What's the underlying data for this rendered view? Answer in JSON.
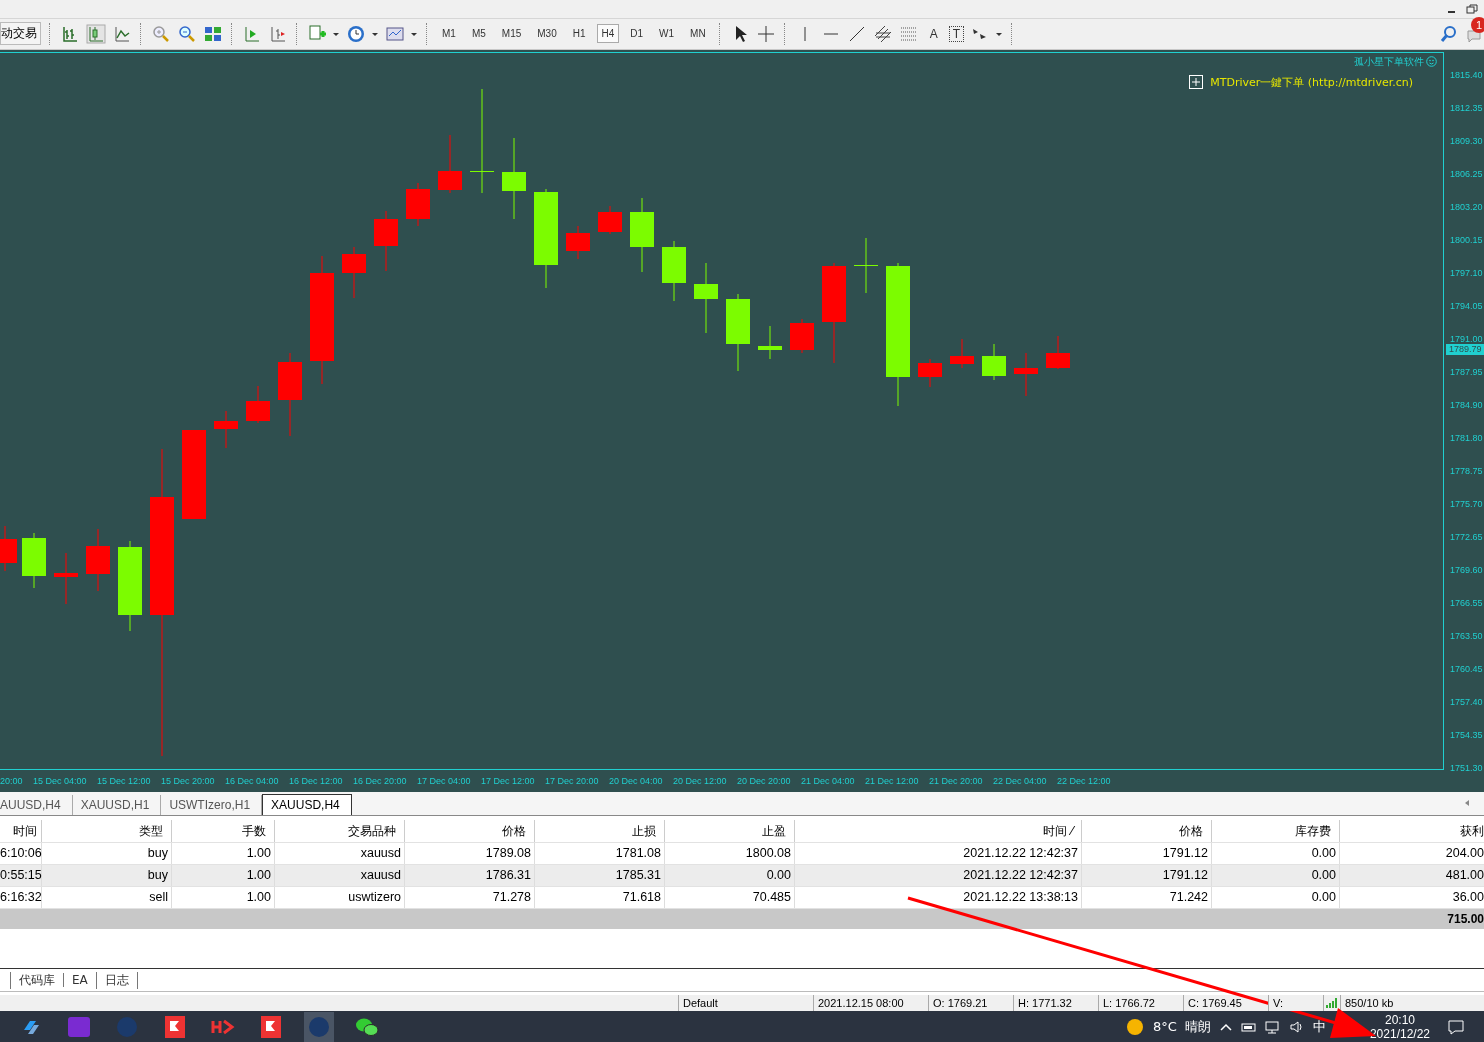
{
  "toolbar": {
    "autotrade_label": "动交易",
    "timeframes": [
      {
        "label": "M1",
        "selected": false
      },
      {
        "label": "M5",
        "selected": false
      },
      {
        "label": "M15",
        "selected": false
      },
      {
        "label": "M30",
        "selected": false
      },
      {
        "label": "H1",
        "selected": false
      },
      {
        "label": "H4",
        "selected": true
      },
      {
        "label": "D1",
        "selected": false
      },
      {
        "label": "W1",
        "selected": false
      },
      {
        "label": "MN",
        "selected": false
      }
    ],
    "text_tools": [
      "A",
      "T"
    ],
    "notification_count": "1"
  },
  "chart": {
    "branding": "孤小星下单软件",
    "plugin_label": "MTDriver一鍵下单 (http://mtdriver.cn)",
    "price_ticks": [
      "1815.40",
      "1812.35",
      "1809.30",
      "1806.25",
      "1803.20",
      "1800.15",
      "1797.10",
      "1794.05",
      "1791.00",
      "1787.95",
      "1784.90",
      "1781.80",
      "1778.75",
      "1775.70",
      "1772.65",
      "1769.60",
      "1766.55",
      "1763.50",
      "1760.45",
      "1757.40",
      "1754.35",
      "1751.30"
    ],
    "current_price": "1789.79",
    "time_labels": [
      "20:00",
      "15 Dec 04:00",
      "15 Dec 12:00",
      "15 Dec 20:00",
      "16 Dec 04:00",
      "16 Dec 12:00",
      "16 Dec 20:00",
      "17 Dec 04:00",
      "17 Dec 12:00",
      "17 Dec 20:00",
      "20 Dec 04:00",
      "20 Dec 12:00",
      "20 Dec 20:00",
      "21 Dec 04:00",
      "21 Dec 12:00",
      "21 Dec 20:00",
      "22 Dec 04:00",
      "22 Dec 12:00"
    ]
  },
  "chart_tabs": [
    {
      "label": "AUUSD,H4",
      "selected": false
    },
    {
      "label": "XAUUSD,H1",
      "selected": false
    },
    {
      "label": "USWTIzero,H1",
      "selected": false
    },
    {
      "label": "XAUUSD,H4",
      "selected": true
    }
  ],
  "trades": {
    "columns": [
      "时间",
      "类型",
      "手数",
      "交易品种",
      "价格",
      "止损",
      "止盈",
      "时间 ⁄",
      "价格",
      "库存费",
      "获利"
    ],
    "rows": [
      [
        "6:10:06",
        "buy",
        "1.00",
        "xauusd",
        "1789.08",
        "1781.08",
        "1800.08",
        "2021.12.22 12:42:37",
        "1791.12",
        "0.00",
        "204.00"
      ],
      [
        "0:55:15",
        "buy",
        "1.00",
        "xauusd",
        "1786.31",
        "1785.31",
        "0.00",
        "2021.12.22 12:42:37",
        "1791.12",
        "0.00",
        "481.00"
      ],
      [
        "6:16:32",
        "sell",
        "1.00",
        "uswtizero",
        "71.278",
        "71.618",
        "70.485",
        "2021.12.22 13:38:13",
        "71.242",
        "0.00",
        "36.00"
      ]
    ],
    "total": "715.00"
  },
  "bottom_tabs": [
    "代码库",
    "EA",
    "日志"
  ],
  "status_bar": [
    "Default",
    "2021.12.15 08:00",
    "O: 1769.21",
    "H: 1771.32",
    "L: 1766.72",
    "C: 1769.45",
    "V:",
    "850/10 kb"
  ],
  "taskbar": {
    "weather_temp": "8°C",
    "weather_text": "晴朗",
    "ime": "中",
    "time": "20:10",
    "date": "2021/12/22"
  }
}
